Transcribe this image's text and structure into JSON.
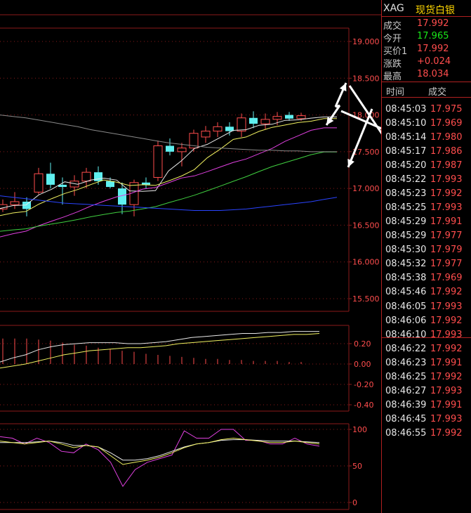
{
  "instrument": {
    "code": "XAG",
    "name": "现货白银"
  },
  "quote": [
    {
      "label": "成交",
      "value": "17.992",
      "color": "red"
    },
    {
      "label": "今开",
      "value": "17.965",
      "color": "green"
    },
    {
      "label": "买价1",
      "value": "17.992",
      "color": "red"
    },
    {
      "label": "涨跌",
      "value": "+0.024",
      "color": "red"
    },
    {
      "label": "最高",
      "value": "18.034",
      "color": "red"
    }
  ],
  "ticks_header": {
    "time": "时间",
    "volume": "成交"
  },
  "ticks": [
    {
      "time": "08:45:03",
      "price": "17.975"
    },
    {
      "time": "08:45:10",
      "price": "17.969"
    },
    {
      "time": "08:45:14",
      "price": "17.980"
    },
    {
      "time": "08:45:17",
      "price": "17.986"
    },
    {
      "time": "08:45:20",
      "price": "17.987"
    },
    {
      "time": "08:45:22",
      "price": "17.993"
    },
    {
      "time": "08:45:23",
      "price": "17.992"
    },
    {
      "time": "08:45:25",
      "price": "17.993"
    },
    {
      "time": "08:45:29",
      "price": "17.991"
    },
    {
      "time": "08:45:29",
      "price": "17.977"
    },
    {
      "time": "08:45:30",
      "price": "17.979"
    },
    {
      "time": "08:45:32",
      "price": "17.977"
    },
    {
      "time": "08:45:38",
      "price": "17.969"
    },
    {
      "time": "08:45:46",
      "price": "17.992"
    },
    {
      "time": "08:46:05",
      "price": "17.993"
    },
    {
      "time": "08:46:06",
      "price": "17.992"
    },
    {
      "time": "08:46:10",
      "price": "17.993"
    },
    {
      "time": "08:46:22",
      "price": "17.992"
    },
    {
      "time": "08:46:23",
      "price": "17.991"
    },
    {
      "time": "08:46:25",
      "price": "17.992"
    },
    {
      "time": "08:46:27",
      "price": "17.993"
    },
    {
      "time": "08:46:39",
      "price": "17.991"
    },
    {
      "time": "08:46:45",
      "price": "17.993"
    },
    {
      "time": "08:46:55",
      "price": "17.992"
    }
  ],
  "colors": {
    "up": "#ff4d4d",
    "down": "#5ff0f0",
    "grid": "#8b1a1a",
    "ma_white": "#e8e8e8",
    "ma_yellow": "#f0f060",
    "ma_magenta": "#e040e0",
    "ma_green": "#40d040",
    "ma_blue": "#2a44ff",
    "ma_gray": "#8a8a8a",
    "green_text": "#19e619"
  },
  "chart_data": [
    {
      "type": "candlestick",
      "y_ticks": [
        "19.000",
        "18.500",
        "18.000",
        "17.500",
        "17.000",
        "16.500",
        "16.000",
        "15.500"
      ],
      "ylim": [
        15.5,
        19.0
      ],
      "candles": [
        {
          "o": 16.72,
          "h": 16.85,
          "l": 16.68,
          "c": 16.78
        },
        {
          "o": 16.78,
          "h": 16.95,
          "l": 16.72,
          "c": 16.82
        },
        {
          "o": 16.82,
          "h": 16.88,
          "l": 16.62,
          "c": 16.72
        },
        {
          "o": 16.95,
          "h": 17.28,
          "l": 16.92,
          "c": 17.2
        },
        {
          "o": 17.2,
          "h": 17.35,
          "l": 17.0,
          "c": 17.05
        },
        {
          "o": 17.05,
          "h": 17.15,
          "l": 16.78,
          "c": 17.02
        },
        {
          "o": 17.02,
          "h": 17.18,
          "l": 16.9,
          "c": 17.1
        },
        {
          "o": 17.1,
          "h": 17.28,
          "l": 17.0,
          "c": 17.22
        },
        {
          "o": 17.22,
          "h": 17.3,
          "l": 17.05,
          "c": 17.1
        },
        {
          "o": 17.1,
          "h": 17.15,
          "l": 17.0,
          "c": 17.02
        },
        {
          "o": 17.0,
          "h": 17.08,
          "l": 16.65,
          "c": 16.78
        },
        {
          "o": 16.78,
          "h": 17.12,
          "l": 16.62,
          "c": 17.08
        },
        {
          "o": 17.08,
          "h": 17.15,
          "l": 17.0,
          "c": 17.05
        },
        {
          "o": 17.15,
          "h": 17.65,
          "l": 17.1,
          "c": 17.58
        },
        {
          "o": 17.58,
          "h": 17.68,
          "l": 17.45,
          "c": 17.5
        },
        {
          "o": 17.5,
          "h": 17.62,
          "l": 17.3,
          "c": 17.55
        },
        {
          "o": 17.55,
          "h": 17.8,
          "l": 17.5,
          "c": 17.75
        },
        {
          "o": 17.7,
          "h": 17.85,
          "l": 17.62,
          "c": 17.78
        },
        {
          "o": 17.78,
          "h": 17.9,
          "l": 17.7,
          "c": 17.84
        },
        {
          "o": 17.84,
          "h": 17.9,
          "l": 17.72,
          "c": 17.78
        },
        {
          "o": 17.78,
          "h": 18.02,
          "l": 17.7,
          "c": 17.96
        },
        {
          "o": 17.96,
          "h": 18.05,
          "l": 17.82,
          "c": 17.88
        },
        {
          "o": 17.88,
          "h": 18.02,
          "l": 17.8,
          "c": 17.94
        },
        {
          "o": 17.94,
          "h": 18.04,
          "l": 17.86,
          "c": 17.98
        },
        {
          "o": 18.0,
          "h": 18.04,
          "l": 17.92,
          "c": 17.95
        },
        {
          "o": 17.95,
          "h": 18.03,
          "l": 17.92,
          "c": 17.99
        }
      ]
    },
    {
      "type": "bar+line",
      "y_ticks": [
        "0.20",
        "0.00",
        "-0.20",
        "-0.40"
      ],
      "ylim": [
        -0.45,
        0.35
      ],
      "bars": [
        0.25,
        0.25,
        0.25,
        0.24,
        0.23,
        0.21,
        0.19,
        0.18,
        0.16,
        0.15,
        0.13,
        0.12,
        0.1,
        0.09,
        0.08,
        0.07,
        0.06,
        0.05,
        0.05,
        0.04,
        0.04,
        0.03,
        0.03,
        0.03,
        0.02,
        0.02
      ],
      "line_white": [
        0.02,
        0.06,
        0.09,
        0.14,
        0.17,
        0.19,
        0.2,
        0.21,
        0.21,
        0.21,
        0.2,
        0.2,
        0.21,
        0.22,
        0.24,
        0.26,
        0.27,
        0.28,
        0.29,
        0.3,
        0.3,
        0.31,
        0.31,
        0.32,
        0.32,
        0.32
      ],
      "line_yellow": [
        -0.04,
        -0.02,
        0.0,
        0.03,
        0.06,
        0.09,
        0.11,
        0.13,
        0.14,
        0.15,
        0.16,
        0.16,
        0.17,
        0.18,
        0.2,
        0.21,
        0.22,
        0.23,
        0.24,
        0.25,
        0.26,
        0.27,
        0.28,
        0.29,
        0.29,
        0.3
      ]
    },
    {
      "type": "line",
      "y_ticks": [
        "100",
        "50",
        "0"
      ],
      "ylim": [
        0,
        100
      ],
      "magenta": [
        90,
        88,
        80,
        88,
        82,
        70,
        68,
        80,
        72,
        55,
        22,
        45,
        55,
        60,
        65,
        98,
        88,
        88,
        100,
        100,
        85,
        85,
        80,
        80,
        88,
        80,
        77
      ],
      "yellow": [
        84,
        82,
        80,
        82,
        84,
        80,
        75,
        78,
        76,
        64,
        52,
        55,
        58,
        62,
        68,
        75,
        80,
        82,
        86,
        88,
        86,
        84,
        82,
        82,
        84,
        82,
        80
      ],
      "white": [
        82,
        82,
        82,
        83,
        84,
        82,
        78,
        78,
        76,
        68,
        58,
        58,
        60,
        64,
        70,
        76,
        80,
        82,
        85,
        86,
        86,
        85,
        84,
        84,
        84,
        83,
        82
      ]
    }
  ]
}
